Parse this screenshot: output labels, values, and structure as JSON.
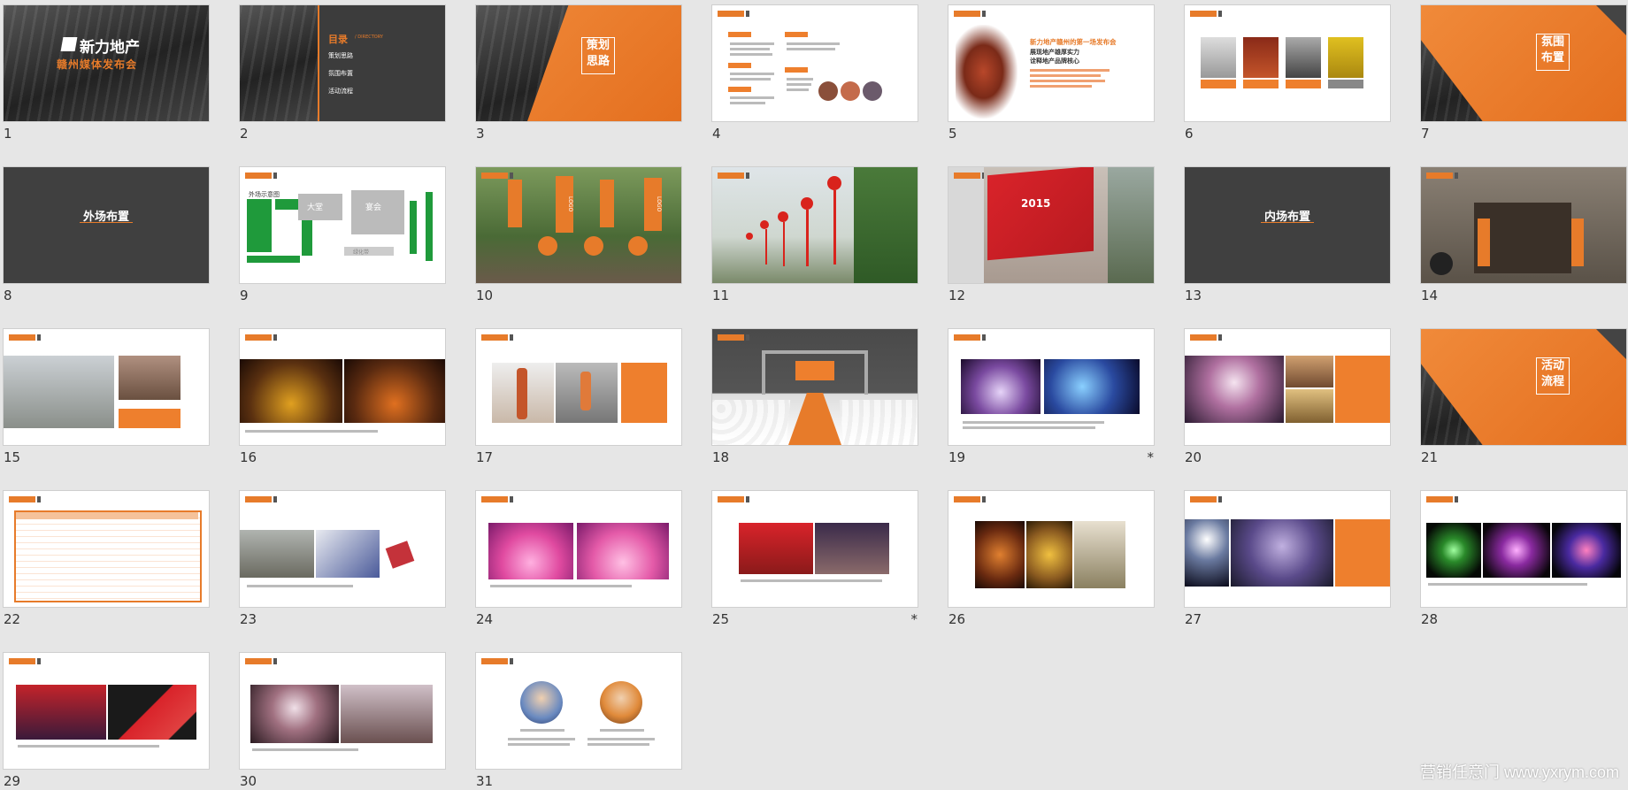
{
  "slides": [
    {
      "num": "1",
      "star": ""
    },
    {
      "num": "2",
      "star": ""
    },
    {
      "num": "3",
      "star": ""
    },
    {
      "num": "4",
      "star": ""
    },
    {
      "num": "5",
      "star": ""
    },
    {
      "num": "6",
      "star": ""
    },
    {
      "num": "7",
      "star": ""
    },
    {
      "num": "8",
      "star": ""
    },
    {
      "num": "9",
      "star": ""
    },
    {
      "num": "10",
      "star": ""
    },
    {
      "num": "11",
      "star": ""
    },
    {
      "num": "12",
      "star": ""
    },
    {
      "num": "13",
      "star": ""
    },
    {
      "num": "14",
      "star": ""
    },
    {
      "num": "15",
      "star": ""
    },
    {
      "num": "16",
      "star": ""
    },
    {
      "num": "17",
      "star": ""
    },
    {
      "num": "18",
      "star": ""
    },
    {
      "num": "19",
      "star": "*"
    },
    {
      "num": "20",
      "star": ""
    },
    {
      "num": "21",
      "star": ""
    },
    {
      "num": "22",
      "star": ""
    },
    {
      "num": "23",
      "star": ""
    },
    {
      "num": "24",
      "star": ""
    },
    {
      "num": "25",
      "star": "*"
    },
    {
      "num": "26",
      "star": ""
    },
    {
      "num": "27",
      "star": ""
    },
    {
      "num": "28",
      "star": ""
    },
    {
      "num": "29",
      "star": ""
    },
    {
      "num": "30",
      "star": ""
    },
    {
      "num": "31",
      "star": ""
    }
  ],
  "s1": {
    "brand": "新力地产",
    "event": "赣州媒体发布会"
  },
  "s2": {
    "title": "目录",
    "title_en": "/ DIRECTORY",
    "items": [
      "策划思路",
      "氛围布置",
      "活动流程"
    ]
  },
  "s3": {
    "title": "策划\n思路"
  },
  "s5": {
    "headline": "新力地产赣州的第一场发布会",
    "sub1": "展现地产雄厚实力",
    "sub2": "诠释地产品牌核心"
  },
  "s7": {
    "title": "氛围\n布置"
  },
  "s8": {
    "title": "外场布置"
  },
  "s9": {
    "label": "外场示意图",
    "hall1": "大堂",
    "hall2": "宴会",
    "lawn": "绿化带"
  },
  "s10": {
    "logo": "LOGO"
  },
  "s12": {
    "year": "2015"
  },
  "s13": {
    "title": "内场布置"
  },
  "s21": {
    "title": "活动\n流程"
  },
  "watermark": "营销任意门 www.yxrym.com",
  "colors": {
    "accent": "#ee7f2d",
    "background": "#e6e6e6"
  }
}
